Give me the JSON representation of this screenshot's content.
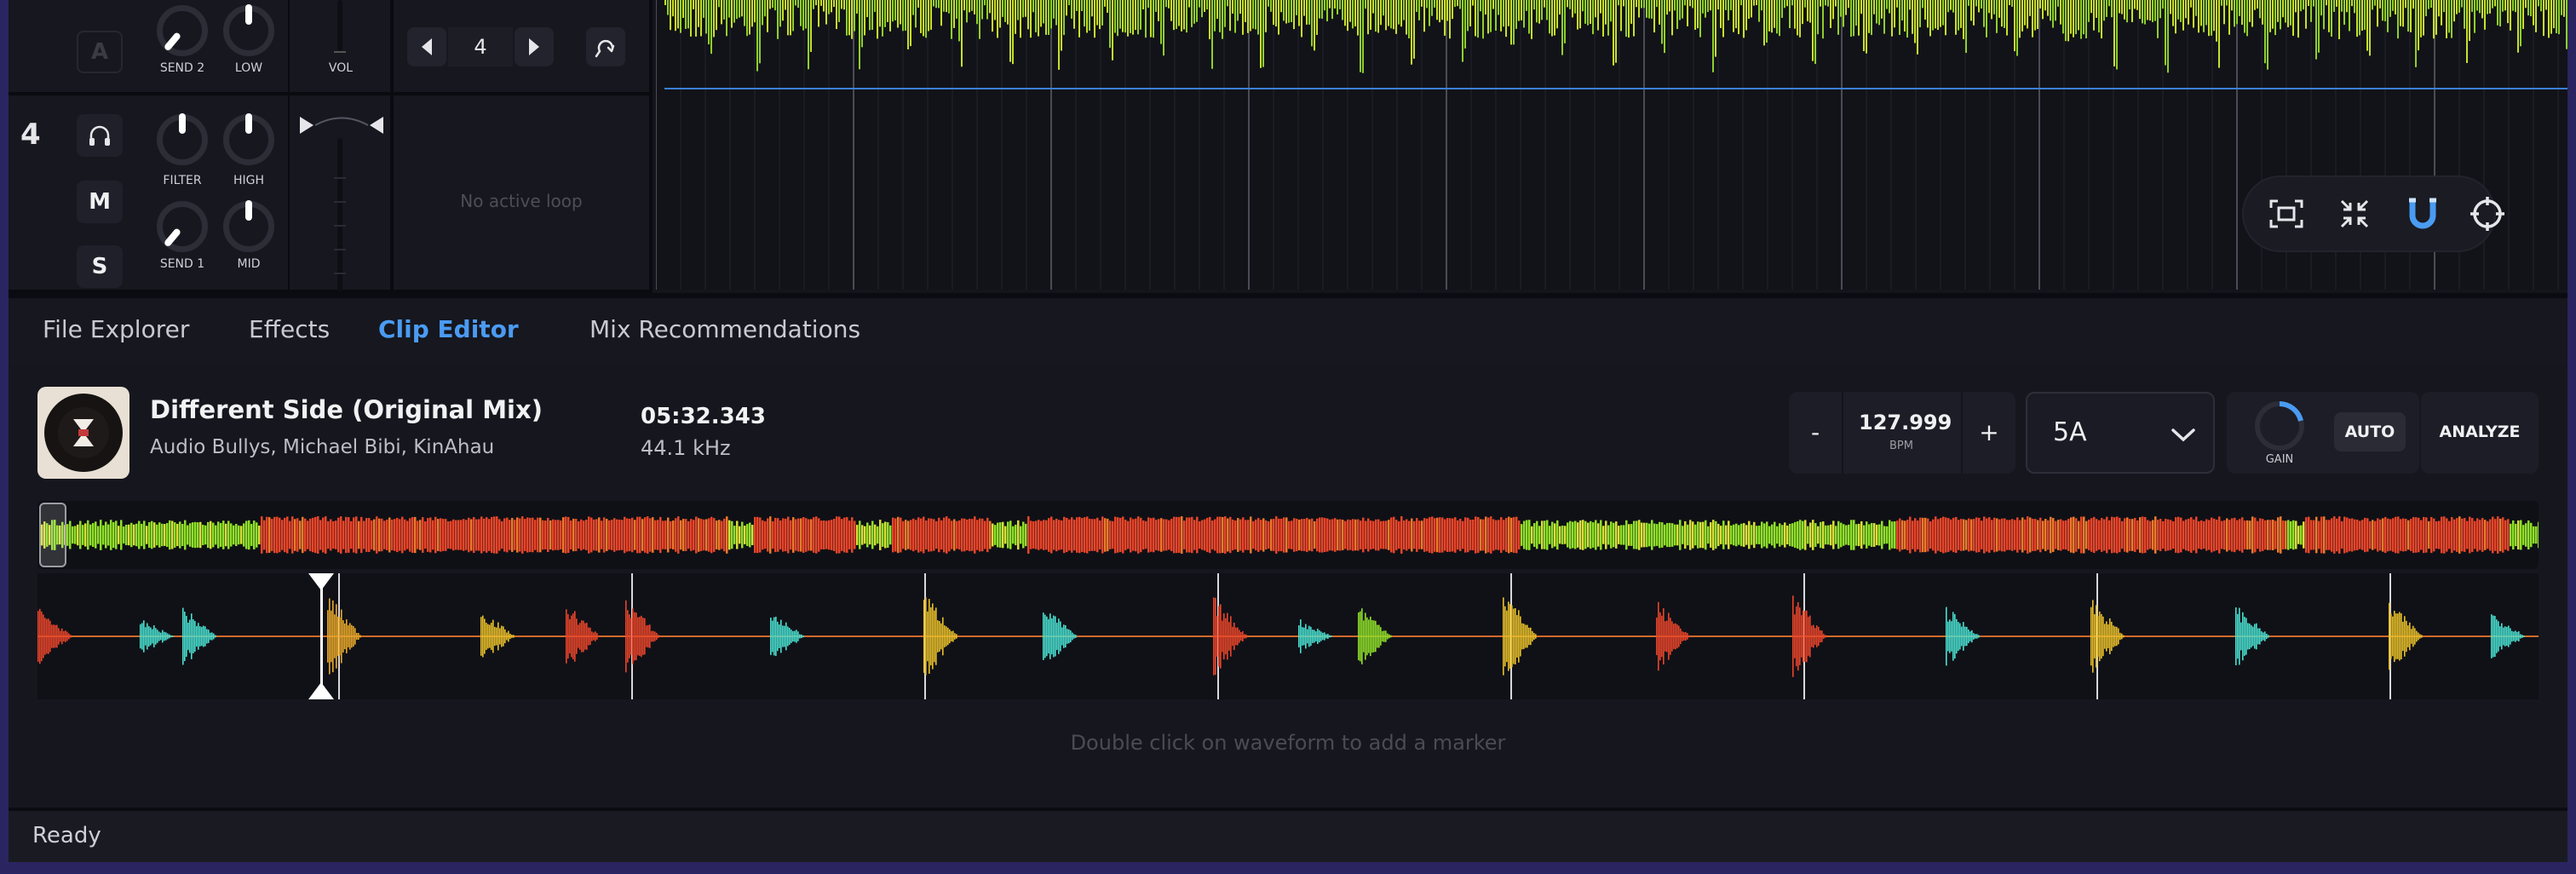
{
  "decks": {
    "deck3": {
      "mute_hint": "A",
      "knobs": [
        "SEND 2",
        "LOW"
      ],
      "fader_label": "VOL"
    },
    "deck4": {
      "number": "4",
      "buttons": [
        "M",
        "S"
      ],
      "knobs": [
        "FILTER",
        "HIGH",
        "SEND 1",
        "MID"
      ]
    }
  },
  "loop": {
    "beats": "4",
    "empty_text": "No active loop"
  },
  "tabs": [
    {
      "label": "File Explorer"
    },
    {
      "label": "Effects"
    },
    {
      "label": "Clip Editor",
      "active": true
    },
    {
      "label": "Mix Recommendations"
    }
  ],
  "track": {
    "title": "Different Side (Original Mix)",
    "artist": "Audio Bullys, Michael Bibi, KinAhau",
    "duration": "05:32.343",
    "sample_rate": "44.1 kHz"
  },
  "bpm": {
    "minus": "-",
    "value": "127.999",
    "unit": "BPM",
    "plus": "+"
  },
  "key": {
    "value": "5A"
  },
  "gain": {
    "label": "GAIN",
    "auto_label": "AUTO",
    "analyze_label": "ANALYZE"
  },
  "hint_text": "Double click on waveform to add a marker",
  "status": "Ready",
  "colors": {
    "accent": "#4a9bf2",
    "waveform_red": "#e8452a",
    "waveform_green": "#8fe02a",
    "waveform_cyan": "#49e0d0"
  }
}
